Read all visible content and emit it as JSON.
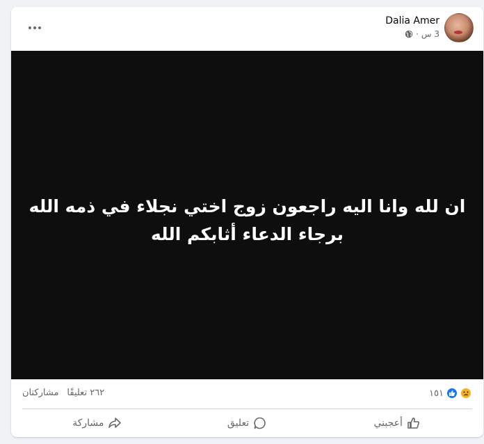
{
  "post": {
    "author": "Dalia Amer",
    "time": "3 س",
    "separator": "·",
    "privacy_icon": "globe-icon",
    "image_text_line1": "ان لله وانا اليه راجعون زوج اختي نجلاء في ذمه الله",
    "image_text_line2": "برجاء الدعاء أثابكم الله"
  },
  "stats": {
    "reaction_count": "١٥١",
    "comments": "٢٦٢ تعليقًا",
    "shares": "مشاركتان"
  },
  "actions": {
    "like": "أعجبني",
    "comment": "تعليق",
    "share": "مشاركة"
  },
  "colors": {
    "like_blue": "#1877f2",
    "sad_yellow": "#f7b125",
    "muted_text": "#65676b",
    "image_bg": "#0e0e0e"
  }
}
